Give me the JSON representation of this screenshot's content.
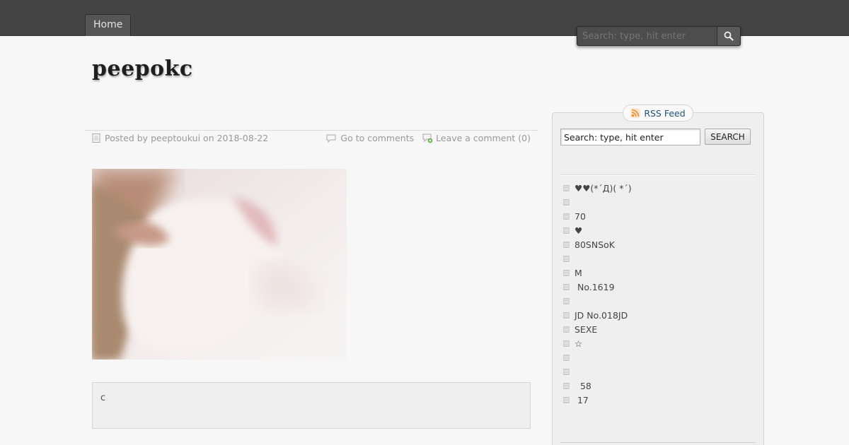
{
  "nav": {
    "tabs": [
      {
        "label": "Home"
      }
    ]
  },
  "header_search": {
    "placeholder": "Search: type, hit enter"
  },
  "site": {
    "title": "peepokc"
  },
  "post": {
    "meta": {
      "posted_by_prefix": "Posted by",
      "author": "peeptoukui",
      "on_word": "on",
      "date": "2018-08-22",
      "comments_link": "Go to comments",
      "leave_comment": "Leave a comment (0)"
    },
    "body_text": "c"
  },
  "sidebar": {
    "rss_label": "RSS Feed",
    "search": {
      "value": "Search: type, hit enter",
      "button": "SEARCH"
    },
    "items": [
      {
        "label": "♥♥(*´Д)( *´)"
      },
      {
        "label": ""
      },
      {
        "label": "70"
      },
      {
        "label": "♥"
      },
      {
        "label": "80SNSoK"
      },
      {
        "label": ""
      },
      {
        "label": "M"
      },
      {
        "label": " No.1619"
      },
      {
        "label": ""
      },
      {
        "label": "JD No.018JD"
      },
      {
        "label": "SEXE"
      },
      {
        "label": "☆"
      },
      {
        "label": ""
      },
      {
        "label": ""
      },
      {
        "label": "  58"
      },
      {
        "label": " 17"
      }
    ]
  },
  "icons": {
    "search": "magnifier-icon",
    "post": "document-icon",
    "comments": "speech-bubble-icon",
    "add_comment": "comment-add-icon",
    "rss": "rss-icon",
    "bullet": "list-bullet-icon"
  },
  "colors": {
    "topbar": "#444444",
    "link_blue": "#1d4f7a",
    "background": "#f7f7f7"
  }
}
